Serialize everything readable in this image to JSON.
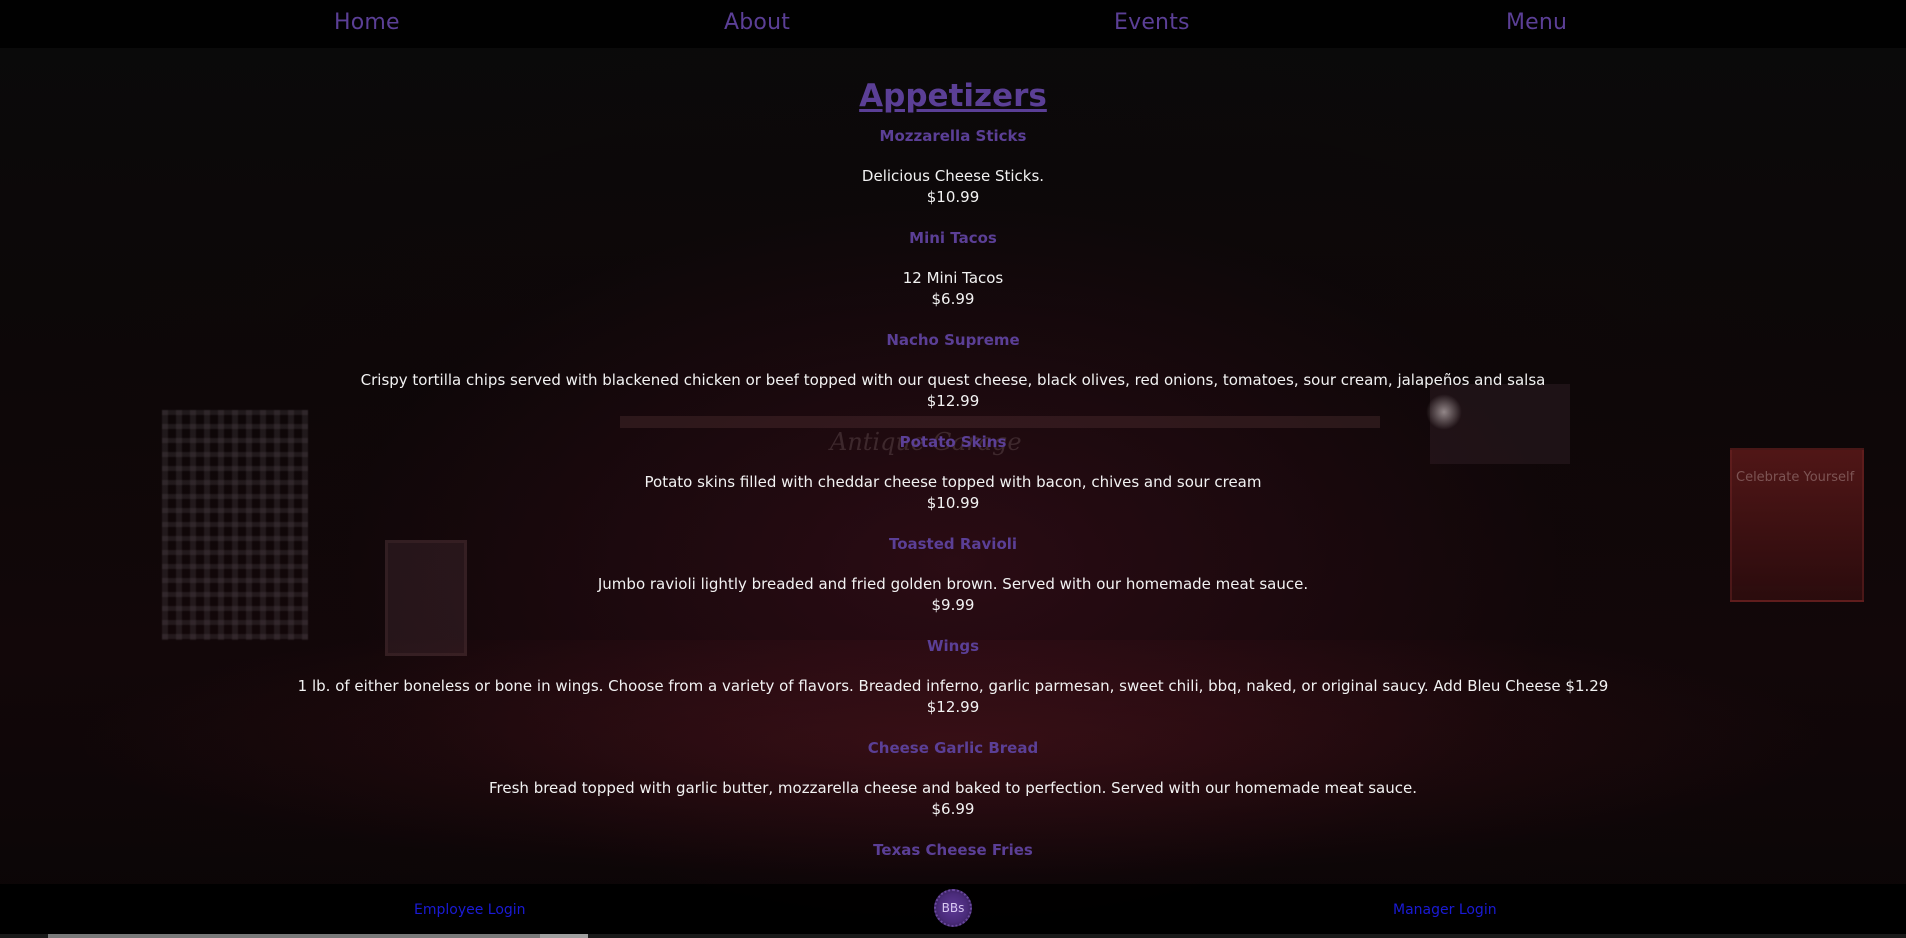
{
  "nav": {
    "items": [
      {
        "label": "Home"
      },
      {
        "label": "About"
      },
      {
        "label": "Events"
      },
      {
        "label": "Menu"
      }
    ]
  },
  "background": {
    "sign_text": "Celebrate Yourself",
    "bar_name": "Antique Garage"
  },
  "menu": {
    "section_title": "Appetizers",
    "items": [
      {
        "name": "Mozzarella Sticks",
        "description": "Delicious Cheese Sticks.",
        "price": "$10.99"
      },
      {
        "name": "Mini Tacos",
        "description": "12 Mini Tacos",
        "price": "$6.99"
      },
      {
        "name": "Nacho Supreme",
        "description": "Crispy tortilla chips served with blackened chicken or beef topped with our quest cheese, black olives, red onions, tomatoes, sour cream, jalapeños and salsa",
        "price": "$12.99"
      },
      {
        "name": "Potato Skins",
        "description": "Potato skins filled with cheddar cheese topped with bacon, chives and sour cream",
        "price": "$10.99"
      },
      {
        "name": "Toasted Ravioli",
        "description": "Jumbo ravioli lightly breaded and fried golden brown. Served with our homemade meat sauce.",
        "price": "$9.99"
      },
      {
        "name": "Wings",
        "description": "1 lb. of either boneless or bone in wings. Choose from a variety of flavors. Breaded inferno, garlic parmesan, sweet chili, bbq, naked, or original saucy. Add Bleu Cheese $1.29",
        "price": "$12.99"
      },
      {
        "name": "Cheese Garlic Bread",
        "description": "Fresh bread topped with garlic butter, mozzarella cheese and baked to perfection. Served with our homemade meat sauce.",
        "price": "$6.99"
      },
      {
        "name": "Texas Cheese Fries",
        "description": "",
        "price": ""
      }
    ]
  },
  "footer": {
    "employee_login": "Employee Login",
    "manager_login": "Manager Login",
    "logo_text": "BBs"
  },
  "colors": {
    "accent": "#5b3f96",
    "link": "#1a1ad6",
    "text": "#f2f2f2"
  }
}
